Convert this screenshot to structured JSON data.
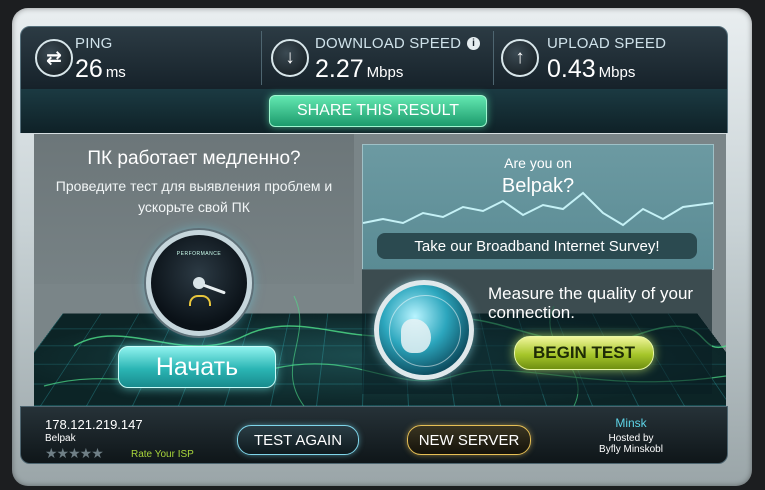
{
  "stats": {
    "ping": {
      "label": "PING",
      "value": "26",
      "unit": "ms",
      "icon": "swap-arrows-icon"
    },
    "download": {
      "label": "DOWNLOAD SPEED",
      "value": "2.27",
      "unit": "Mbps",
      "icon": "arrow-down-icon",
      "info_icon": "i"
    },
    "upload": {
      "label": "UPLOAD SPEED",
      "value": "0.43",
      "unit": "Mbps",
      "icon": "arrow-up-icon"
    }
  },
  "share": {
    "label": "SHARE THIS RESULT"
  },
  "ad_left": {
    "heading": "ПК работает медленно?",
    "subtext": "Проведите тест для выявления проблем и ускорьте свой ПК",
    "gauge_title": "PERFORMANCE",
    "start_label": "Начать"
  },
  "ad_right": {
    "question_line1": "Are you on",
    "question_line2": "Belpak?",
    "survey_label": "Take our Broadband Internet Survey!"
  },
  "measure": {
    "text": "Measure the quality of your connection.",
    "begin_label": "BEGIN TEST"
  },
  "bottom": {
    "ip": "178.121.219.147",
    "isp": "Belpak",
    "stars": "★★★★★",
    "rate_label": "Rate Your ISP",
    "test_again_label": "TEST AGAIN",
    "new_server_label": "NEW SERVER",
    "server_city": "Minsk",
    "hosted_by": "Hosted by",
    "host_name": "Byfly Minskobl"
  },
  "colors": {
    "share_green": "#3fd199",
    "start_teal": "#2bb5b4",
    "begin_lime": "#a6c62a",
    "new_server_gold": "#e6bf55"
  }
}
